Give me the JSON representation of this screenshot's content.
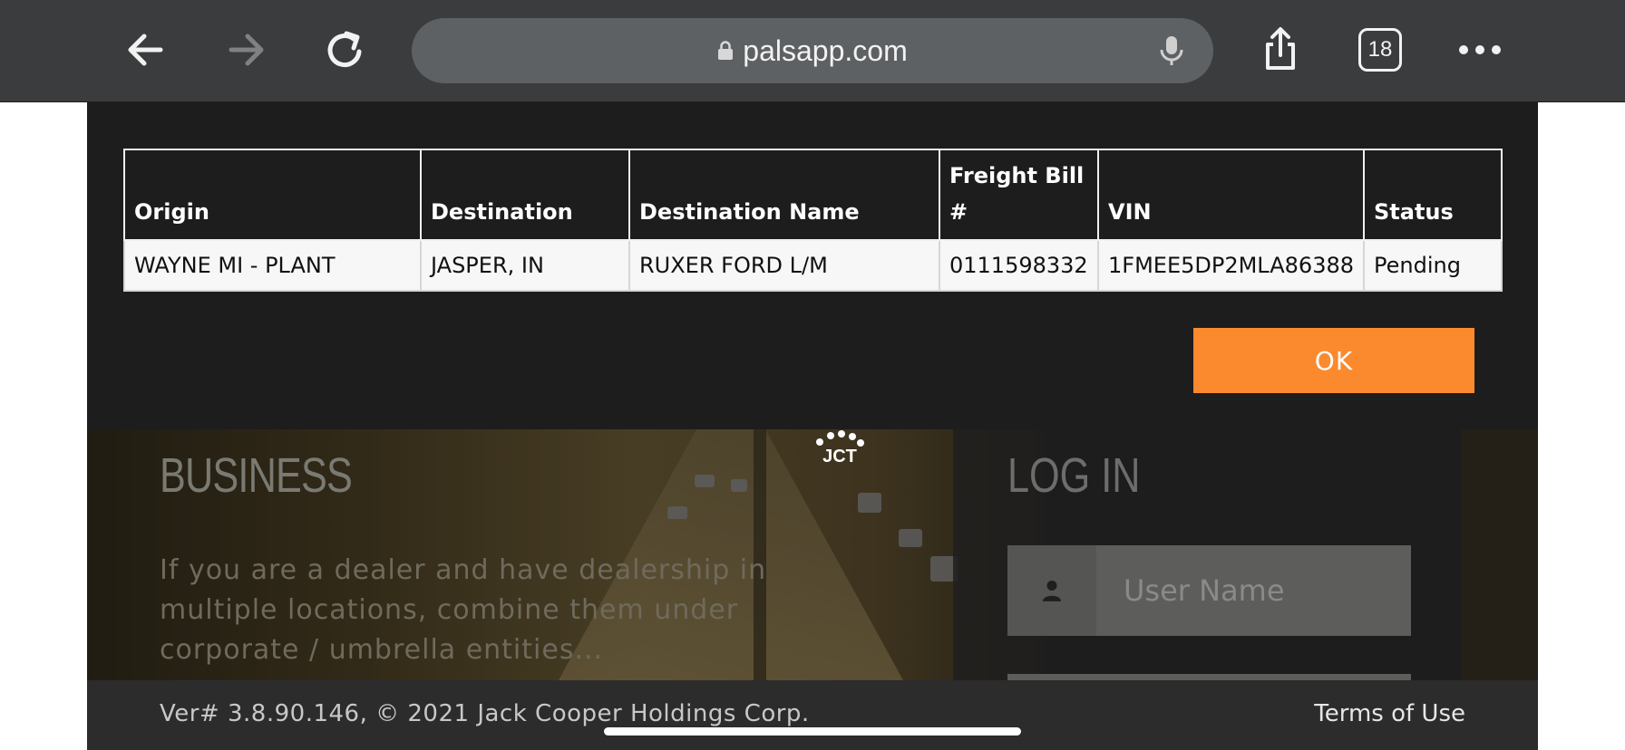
{
  "browser": {
    "url": "palsapp.com",
    "tab_count": "18",
    "icons": [
      "back-arrow-icon",
      "forward-arrow-icon",
      "reload-icon",
      "lock-icon",
      "microphone-icon",
      "share-icon",
      "tabs-icon",
      "more-icon"
    ]
  },
  "modal": {
    "table": {
      "headers": [
        "Origin",
        "Destination",
        "Destination Name",
        "Freight Bill #",
        "VIN",
        "Status"
      ],
      "rows": [
        [
          "WAYNE MI - PLANT",
          "JASPER, IN",
          "RUXER FORD L/M",
          "0111598332",
          "1FMEE5DP2MLA86388",
          "Pending"
        ]
      ]
    },
    "ok_label": "OK",
    "ok_color": "#fb8a2e"
  },
  "business": {
    "title": "BUSINESS",
    "text": "If you are a dealer and have dealership in multiple locations, combine them under corporate / umbrella entities..."
  },
  "logo": {
    "text": "JCT"
  },
  "login": {
    "title": "LOG IN",
    "username_placeholder": "User Name"
  },
  "footer": {
    "version": "Ver# 3.8.90.146, © 2021 Jack Cooper Holdings Corp.",
    "terms": "Terms of Use"
  }
}
